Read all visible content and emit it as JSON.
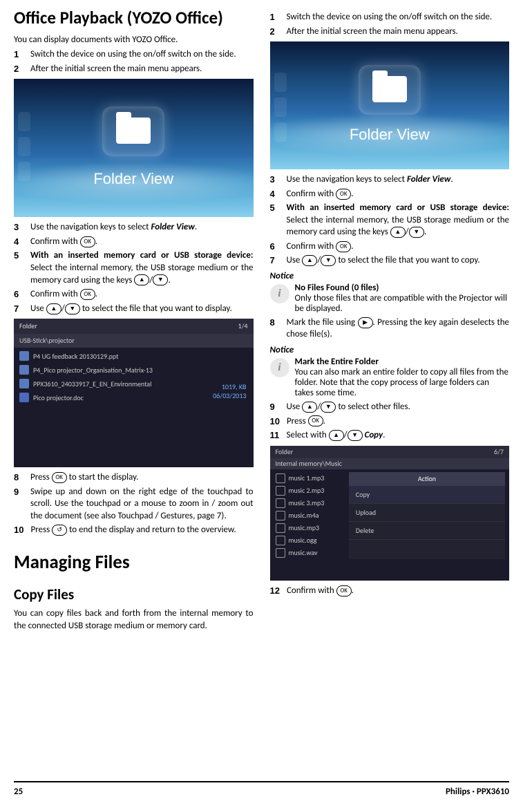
{
  "footer": {
    "left": "25",
    "right": "Philips · PPX3610"
  },
  "left": {
    "h1": "Office Playback (YOZO Office)",
    "intro": "You can display documents with YOZO Office.",
    "steps": {
      "s1": "Switch the device on using the on/off switch on the side.",
      "s2": "After the initial screen the main menu appears.",
      "s3_pre": "Use the navigation keys to select ",
      "s3_b": "Folder View",
      "s3_post": ".",
      "s4": "Confirm with ",
      "s5_b": "With an inserted memory card or USB storage device:",
      "s5_rest": " Select the internal memory, the USB storage medium or the memory card using the keys ",
      "s6": "Confirm with ",
      "s7_pre": "Use ",
      "s7_post": " to select the file that you want to display.",
      "s8_pre": "Press ",
      "s8_post": " to start the display.",
      "s9": "Swipe up and down on the right edge of the touchpad to scroll. Use the touchpad or a mouse to zoom in / zoom out the document (see also Touchpad / Gestures, page 7).",
      "s10_pre": "Press ",
      "s10_post": " to end the display and return to the overview."
    },
    "folderview_label": "Folder View",
    "flist": {
      "hdr_left": "Folder",
      "hdr_right": "1/4",
      "crumb": "USB-Stick\\projector",
      "rows": [
        "P4 UG feedback 20130129.ppt",
        "P4_Pico projector_Organisation_Matrix-13",
        "PPX3610_24033917_E_EN_Environmental",
        "Pico projector.doc"
      ],
      "meta1": "1019, KB",
      "meta2": "06/03/2013"
    },
    "h1b": "Managing Files",
    "h2": "Copy Files",
    "copy_intro": "You can copy files back and forth from the internal memory to the connected USB storage medium or memory card."
  },
  "right": {
    "steps": {
      "s1": "Switch the device on using the on/off switch on the side.",
      "s2": "After the initial screen the main menu appears.",
      "s3_pre": "Use the navigation keys to select ",
      "s3_b": "Folder View",
      "s3_post": ".",
      "s4": "Confirm with ",
      "s5_b": "With an inserted memory card or USB storage device:",
      "s5_rest": " Select the internal memory, the USB storage medium or the memory card using the keys ",
      "s6": "Confirm with ",
      "s7_pre": "Use ",
      "s7_post": " to select the file that you want to copy.",
      "s8_pre": "Mark the file using ",
      "s8_post": ". Pressing the key again deselects the chose file(s).",
      "s9_pre": "Use ",
      "s9_post": " to select other files.",
      "s10": "Press ",
      "s11_pre": "Select with ",
      "s11_b": "Copy",
      "s11_post": ".",
      "s12": "Confirm with "
    },
    "folderview_label": "Folder View",
    "notice1": {
      "head": "Notice",
      "title": "No Files Found (0 files)",
      "body": "Only those files that are compatible with the Projector will be displayed."
    },
    "notice2": {
      "head": "Notice",
      "title": "Mark the Entire Folder",
      "body": "You can also mark an entire folder to copy all files from the folder. Note that the copy process of large folders can takes some time."
    },
    "actshot": {
      "hdr_left": "Folder",
      "hdr_right": "6/7",
      "crumb": "Internal memory\\Music",
      "rows": [
        "music 1.mp3",
        "music 2.mp3",
        "music 3.mp3",
        "music.m4a",
        "music.mp3",
        "music.ogg",
        "music.wav"
      ],
      "menu_hdr": "Action",
      "menu_items": [
        "Copy",
        "Upload",
        "Delete"
      ]
    }
  },
  "keys": {
    "ok": "OK",
    "up": "▲",
    "down": "▼",
    "right": "▶",
    "back": "↺"
  }
}
